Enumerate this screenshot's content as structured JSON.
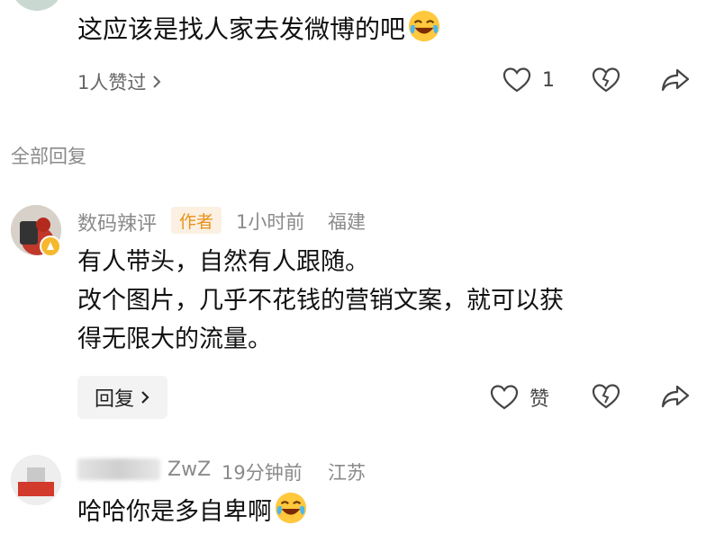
{
  "top_comment": {
    "text": "这应该是找人家去发微博的吧",
    "likers": "1人赞过",
    "like_count": "1"
  },
  "section_title": "全部回复",
  "author_reply": {
    "username": "数码辣评",
    "author_tag": "作者",
    "time": "1小时前",
    "location": "福建",
    "line1": "有人带头，自然有人跟随。",
    "line2": "改个图片，几乎不花钱的营销文案，就可以获",
    "line3": "得无限大的流量。",
    "reply_label": "回复",
    "like_label": "赞"
  },
  "third_reply": {
    "username": "ZwZ",
    "time": "19分钟前",
    "location": "江苏",
    "text": "哈哈你是多自卑啊"
  },
  "icons": {
    "heart": "heart-icon",
    "dislike": "broken-heart-icon",
    "share": "share-icon",
    "chevron": "chevron-right-icon",
    "emoji": "laughing-crying-emoji"
  },
  "colors": {
    "tag_bg": "#fbf0e2",
    "tag_text": "#e8911b",
    "meta_gray": "#8a8a8a"
  }
}
